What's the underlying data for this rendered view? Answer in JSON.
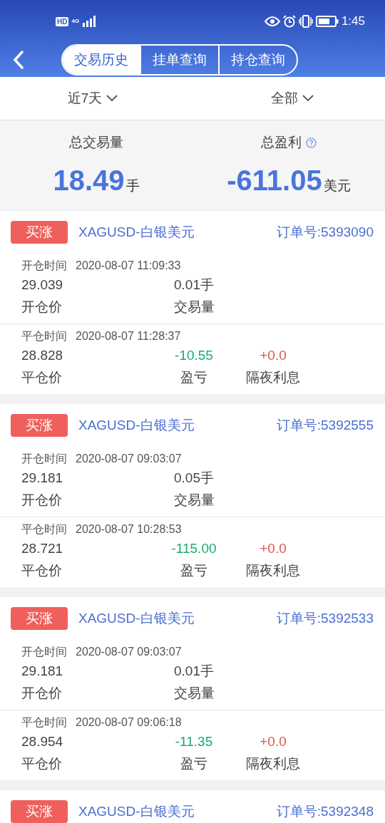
{
  "status_bar": {
    "hd": "HD",
    "network": "4G",
    "time": "1:45"
  },
  "tabs": [
    {
      "label": "交易历史",
      "selected": true
    },
    {
      "label": "挂单查询",
      "selected": false
    },
    {
      "label": "持仓查询",
      "selected": false
    }
  ],
  "filters": [
    {
      "label": "近7天"
    },
    {
      "label": "全部"
    }
  ],
  "summary": [
    {
      "label": "总交易量",
      "value": "18.49",
      "unit": "手",
      "help": false
    },
    {
      "label": "总盈利",
      "value": "-611.05",
      "unit": "美元",
      "help": true
    }
  ],
  "orders": [
    {
      "side": {
        "label": "买涨",
        "kind": "buy"
      },
      "symbol": "XAGUSD-白银美元",
      "order_no": "订单号:5393090",
      "open": {
        "time_label": "开仓时间",
        "time": "2020-08-07 11:09:33",
        "price": "29.039",
        "price_label": "开仓价",
        "volume": "0.01手",
        "volume_label": "交易量"
      },
      "close": {
        "time_label": "平仓时间",
        "time": "2020-08-07 11:28:37",
        "price": "28.828",
        "price_label": "平仓价",
        "pnl": {
          "text": "-10.55",
          "color": "#1aaa6e"
        },
        "pnl_label": "盈亏",
        "swap": {
          "text": "+0.0",
          "color": "#e5554f"
        },
        "swap_label": "隔夜利息"
      }
    },
    {
      "side": {
        "label": "买涨",
        "kind": "buy"
      },
      "symbol": "XAGUSD-白银美元",
      "order_no": "订单号:5392555",
      "open": {
        "time_label": "开仓时间",
        "time": "2020-08-07 09:03:07",
        "price": "29.181",
        "price_label": "开仓价",
        "volume": "0.05手",
        "volume_label": "交易量"
      },
      "close": {
        "time_label": "平仓时间",
        "time": "2020-08-07 10:28:53",
        "price": "28.721",
        "price_label": "平仓价",
        "pnl": {
          "text": "-115.00",
          "color": "#1aaa6e"
        },
        "pnl_label": "盈亏",
        "swap": {
          "text": "+0.0",
          "color": "#e5554f"
        },
        "swap_label": "隔夜利息"
      }
    },
    {
      "side": {
        "label": "买涨",
        "kind": "buy"
      },
      "symbol": "XAGUSD-白银美元",
      "order_no": "订单号:5392533",
      "open": {
        "time_label": "开仓时间",
        "time": "2020-08-07 09:03:07",
        "price": "29.181",
        "price_label": "开仓价",
        "volume": "0.01手",
        "volume_label": "交易量"
      },
      "close": {
        "time_label": "平仓时间",
        "time": "2020-08-07 09:06:18",
        "price": "28.954",
        "price_label": "平仓价",
        "pnl": {
          "text": "-11.35",
          "color": "#1aaa6e"
        },
        "pnl_label": "盈亏",
        "swap": {
          "text": "+0.0",
          "color": "#e5554f"
        },
        "swap_label": "隔夜利息"
      }
    },
    {
      "side": {
        "label": "买涨",
        "kind": "buy"
      },
      "symbol": "XAGUSD-白银美元",
      "order_no": "订单号:5392348"
    }
  ]
}
